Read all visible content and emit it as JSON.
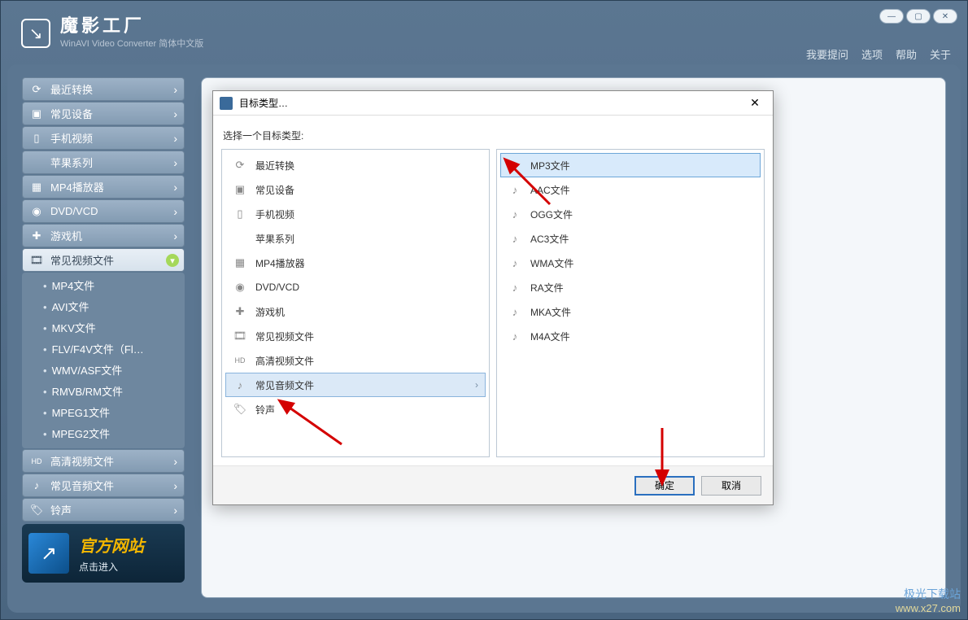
{
  "header": {
    "app_name_cn": "魔影工厂",
    "app_name_en": "WinAVI Video Converter 简体中文版",
    "links": [
      "我要提问",
      "选项",
      "帮助",
      "关于"
    ]
  },
  "sidebar": {
    "cats": [
      {
        "label": "最近转换",
        "icon": "⟳"
      },
      {
        "label": "常见设备",
        "icon": "▣"
      },
      {
        "label": "手机视频",
        "icon": "▯"
      },
      {
        "label": "苹果系列",
        "icon": ""
      },
      {
        "label": "MP4播放器",
        "icon": "▦"
      },
      {
        "label": "DVD/VCD",
        "icon": "◉"
      },
      {
        "label": "游戏机",
        "icon": "✚"
      }
    ],
    "expanded_label": "常见视频文件",
    "expanded_icon": "🎞",
    "sub_items": [
      "MP4文件",
      "AVI文件",
      "MKV文件",
      "FLV/F4V文件（Fl…",
      "WMV/ASF文件",
      "RMVB/RM文件",
      "MPEG1文件",
      "MPEG2文件"
    ],
    "after_cats": [
      {
        "label": "高清视频文件",
        "icon": "HD"
      },
      {
        "label": "常见音频文件",
        "icon": "♪"
      },
      {
        "label": "铃声",
        "icon": "🏷"
      }
    ]
  },
  "banner": {
    "title": "官方网站",
    "subtitle": "点击进入"
  },
  "dialog": {
    "title": "目标类型…",
    "prompt": "选择一个目标类型:",
    "left_items": [
      {
        "label": "最近转换",
        "icon": "⟳"
      },
      {
        "label": "常见设备",
        "icon": "▣"
      },
      {
        "label": "手机视频",
        "icon": "▯"
      },
      {
        "label": "苹果系列",
        "icon": ""
      },
      {
        "label": "MP4播放器",
        "icon": "▦"
      },
      {
        "label": "DVD/VCD",
        "icon": "◉"
      },
      {
        "label": "游戏机",
        "icon": "✚"
      },
      {
        "label": "常见视频文件",
        "icon": "🎞"
      },
      {
        "label": "高清视频文件",
        "icon": "HD"
      },
      {
        "label": "常见音频文件",
        "icon": "♪",
        "selected": true
      },
      {
        "label": "铃声",
        "icon": "🏷"
      }
    ],
    "right_items": [
      {
        "label": "MP3文件",
        "selected": true
      },
      {
        "label": "AAC文件"
      },
      {
        "label": "OGG文件"
      },
      {
        "label": "AC3文件"
      },
      {
        "label": "WMA文件"
      },
      {
        "label": "RA文件"
      },
      {
        "label": "MKA文件"
      },
      {
        "label": "M4A文件"
      }
    ],
    "ok": "确定",
    "cancel": "取消"
  },
  "watermark": {
    "line1": "极光下载站",
    "line2": "www.x27.com"
  }
}
